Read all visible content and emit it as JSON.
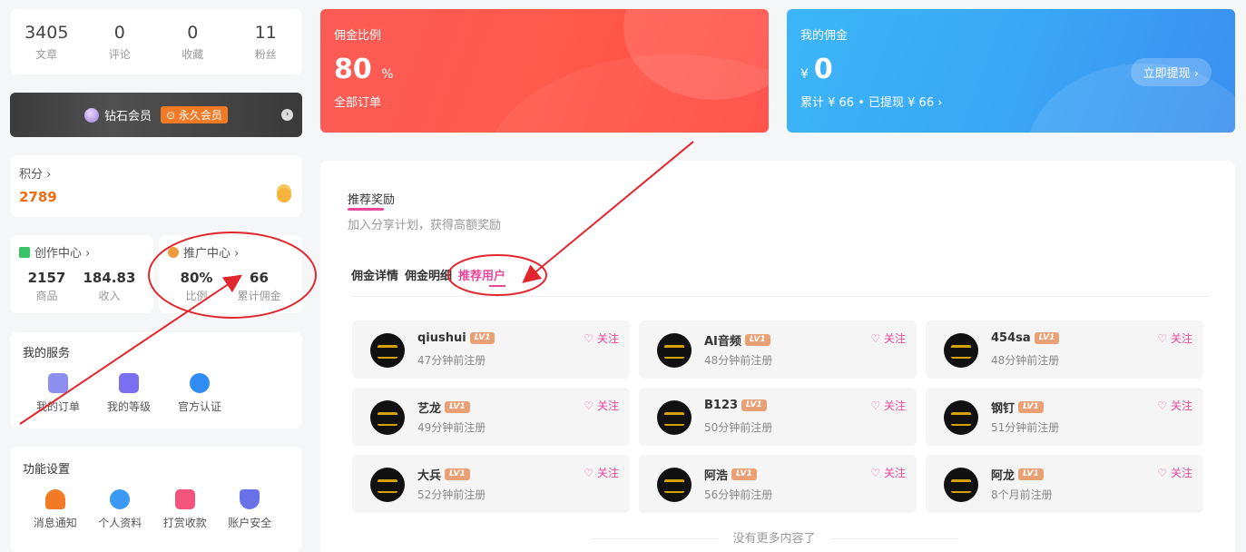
{
  "stats": [
    {
      "num": "3405",
      "label": "文章"
    },
    {
      "num": "0",
      "label": "评论"
    },
    {
      "num": "0",
      "label": "收藏"
    },
    {
      "num": "11",
      "label": "粉丝"
    }
  ],
  "vip": {
    "text": "钻石会员",
    "badge": "⊙ 永久会员",
    "go": "›"
  },
  "points": {
    "title": "积分 ›",
    "value": "2789"
  },
  "creation": {
    "title": "创作中心 ›",
    "items": [
      {
        "n": "2157",
        "l": "商品"
      },
      {
        "n": "184.83",
        "l": "收入"
      }
    ]
  },
  "promotion": {
    "title": "推广中心 ›",
    "items": [
      {
        "n": "80%",
        "l": "比例"
      },
      {
        "n": "66",
        "l": "累计佣金"
      }
    ]
  },
  "services": {
    "title": "我的服务",
    "items": [
      "我的订单",
      "我的等级",
      "官方认证"
    ]
  },
  "settings": {
    "title": "功能设置",
    "items": [
      "消息通知",
      "个人资料",
      "打赏收款",
      "账户安全"
    ]
  },
  "commission": {
    "title": "佣金比例",
    "value": "80",
    "unit": "%",
    "subtitle": "全部订单"
  },
  "my_commission": {
    "title": "我的佣金",
    "currency": "¥",
    "value": "0",
    "summary": "累计 ¥ 66 • 已提现 ¥ 66 ›",
    "withdraw": "立即提现 ›"
  },
  "main": {
    "title": "推荐奖励",
    "subtitle": "加入分享计划，获得高额奖励",
    "tabs": [
      "佣金详情",
      "佣金明细",
      "推荐用户"
    ],
    "users": [
      {
        "name": "qiushui",
        "time": "47分钟前注册"
      },
      {
        "name": "AI音频",
        "time": "48分钟前注册"
      },
      {
        "name": "454sa",
        "time": "48分钟前注册"
      },
      {
        "name": "艺龙",
        "time": "49分钟前注册"
      },
      {
        "name": "B123",
        "time": "50分钟前注册"
      },
      {
        "name": "钢钉",
        "time": "51分钟前注册"
      },
      {
        "name": "大兵",
        "time": "52分钟前注册"
      },
      {
        "name": "阿浩",
        "time": "56分钟前注册"
      },
      {
        "name": "阿龙",
        "time": "8个月前注册"
      }
    ],
    "level_label": "LV1",
    "follow_label": "♡ 关注",
    "no_more": "没有更多内容了"
  },
  "colors": {
    "accent": "#e8489a",
    "red_card": "#ff5a4c",
    "blue_card": "#3aa7f6",
    "annotation": "#e2262d"
  }
}
